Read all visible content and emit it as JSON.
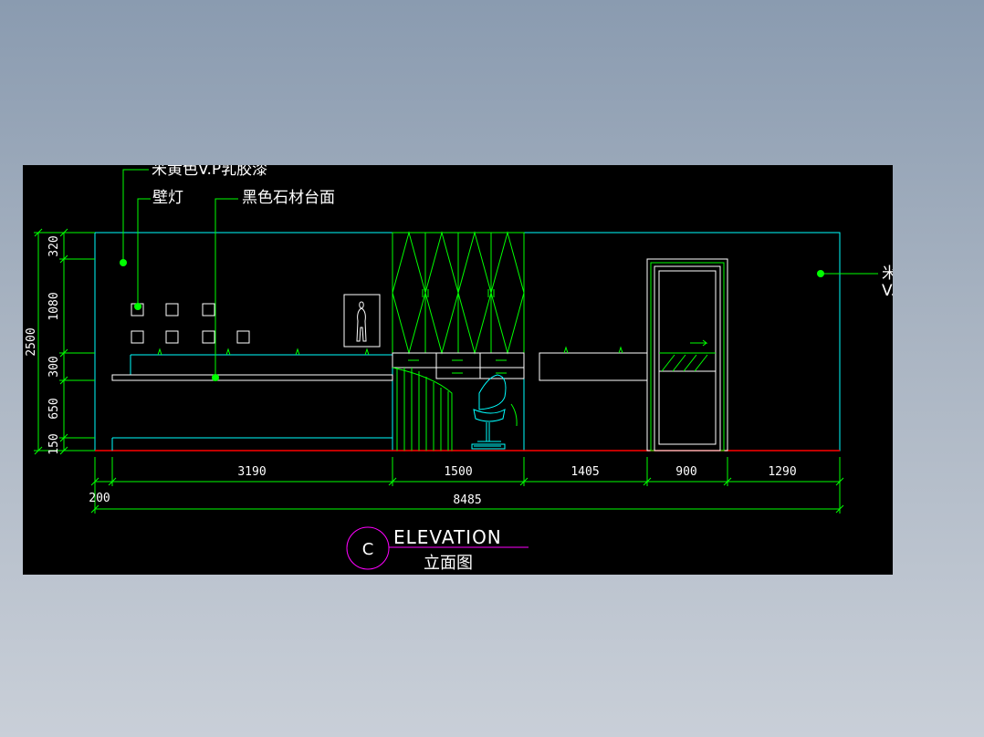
{
  "labels": {
    "top_paint": "米黄色V.P乳胶漆",
    "wall_lamp": "壁灯",
    "stone_counter": "黑色石材台面",
    "right_paint_line1": "米黄色",
    "right_paint_line2": "V.P乳胶漆"
  },
  "dimensions": {
    "vertical": [
      "320",
      "1080",
      "300",
      "650",
      "150"
    ],
    "vertical_total": "2500",
    "horizontal": [
      "3190",
      "1500",
      "1405",
      "900",
      "1290"
    ],
    "horizontal_offset": "200",
    "horizontal_total": "8485"
  },
  "title": {
    "marker": "C",
    "english": "ELEVATION",
    "chinese": "立面图"
  },
  "colors": {
    "background": "#000000",
    "outline": "#00ffff",
    "cabinet": "#00ff00",
    "furniture": "#00ffff",
    "dimension": "#00ff00",
    "floor": "#ff0000",
    "title_circle": "#ff00ff",
    "text": "#ffffff"
  }
}
